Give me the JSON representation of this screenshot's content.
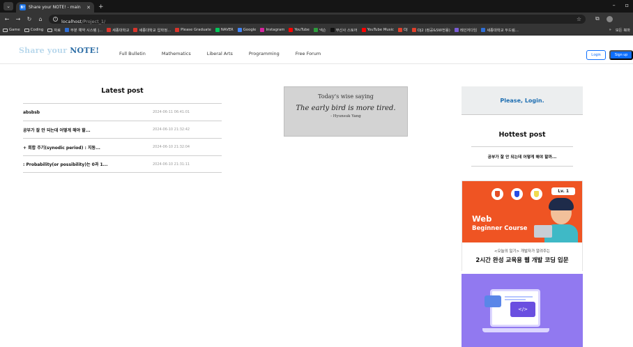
{
  "browser": {
    "tab_title": "Share your NOTE! - main",
    "tab_favicon": "B!",
    "url_host": "localhost",
    "url_path": "/Project_1/",
    "bookmarks": [
      {
        "label": "Game",
        "icon": "folder-icon"
      },
      {
        "label": "Coding",
        "icon": "folder-icon"
      },
      {
        "label": "자료",
        "icon": "folder-icon"
      },
      {
        "label": "무분 예약 시스템 |...",
        "color": "#2f6fd6"
      },
      {
        "label": "세종대학교",
        "color": "#d9342b"
      },
      {
        "label": "세종대학교 입학정...",
        "color": "#d9342b"
      },
      {
        "label": "Please Graduate",
        "color": "#d9342b"
      },
      {
        "label": "NAVER",
        "color": "#03c75a"
      },
      {
        "label": "Google",
        "color": "#4285f4"
      },
      {
        "label": "Instagram",
        "color": "#d6249f"
      },
      {
        "label": "YouTube",
        "color": "#ff0000"
      },
      {
        "label": "넥슨",
        "color": "#2c9c3c"
      },
      {
        "label": "무신사 스토어",
        "color": "#111111"
      },
      {
        "label": "YouTube Music",
        "color": "#ff0000"
      },
      {
        "label": "OJ",
        "color": "#e0402b"
      },
      {
        "label": "OJ2 (컴공&SW전용)",
        "color": "#e0402b"
      },
      {
        "label": "레인저다임",
        "color": "#7a5cd6"
      },
      {
        "label": "세종대학교 두드림...",
        "color": "#2f6fd6"
      }
    ],
    "bookmarks_overflow": "»",
    "all_bookmarks_label": "모든 북마"
  },
  "site": {
    "brand_prefix": "Share your ",
    "brand_note": "NOTE!",
    "nav": [
      "Full Bulletin",
      "Mathematics",
      "Liberal Arts",
      "Programming",
      "Free Forum"
    ],
    "login_label": "Login",
    "signup_label": "Sign up"
  },
  "latest": {
    "title": "Latest post",
    "posts": [
      {
        "title": "absbsb",
        "date": "2024-06-11 06:41:01"
      },
      {
        "title": "공부가 잘 안 되는데 어떻게 해야 할...",
        "date": "2024-06-10 21:32:42"
      },
      {
        "title": "+ 회합 주기(synodic period) : 지동...",
        "date": "2024-06-10 21:32:04"
      },
      {
        "title": ": Probability(or possibility)는 0과 1...",
        "date": "2024-06-10 21:31:11"
      }
    ]
  },
  "wise": {
    "heading": "Today's wise saying",
    "quote": "The early bird is more tired.",
    "author": "- Hyunsuk Yang"
  },
  "sidebar": {
    "login_prompt": "Please, Login.",
    "hottest_title": "Hottest post",
    "hottest_items": [
      "공부가 잘 안 되는데 어떻게 해야 할까..."
    ]
  },
  "ad1": {
    "level": "Lv. 1",
    "line1": "Web",
    "line2": "Beginner Course",
    "subtitle": "<오늘의 일기> 개발자가 알려주는",
    "title": "2시간 완성 교육용 웹 개발 코딩 입문",
    "tech_colors": [
      "#e44d26",
      "#264de4",
      "#f0db4f"
    ],
    "background": "#ef5423"
  },
  "ad2": {
    "code_glyph": "</>",
    "background": "#9179f0"
  }
}
